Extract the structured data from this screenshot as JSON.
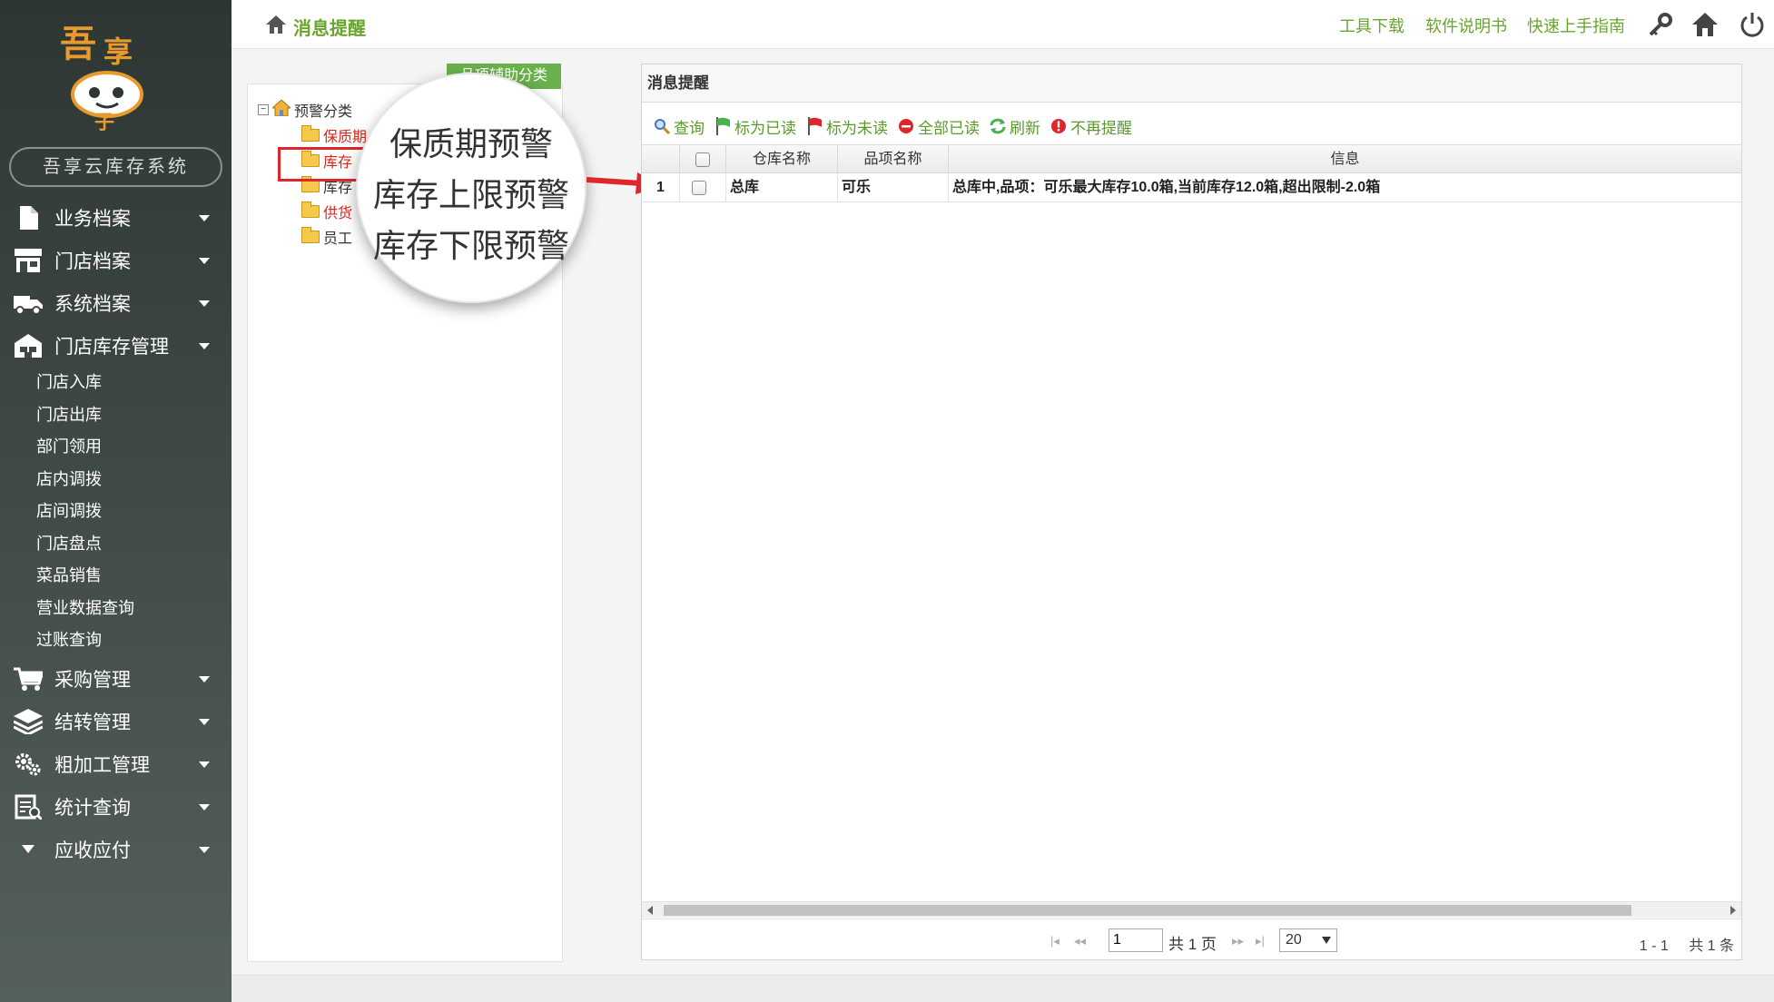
{
  "app": {
    "system_name": "吾享云库存系统"
  },
  "sidebar": {
    "menus": [
      {
        "label": "业务档案",
        "icon": "document-icon"
      },
      {
        "label": "门店档案",
        "icon": "store-icon"
      },
      {
        "label": "系统档案",
        "icon": "truck-icon"
      },
      {
        "label": "门店库存管理",
        "icon": "warehouse-icon"
      }
    ],
    "sub_items": [
      "门店入库",
      "门店出库",
      "部门领用",
      "店内调拨",
      "店间调拨",
      "门店盘点",
      "菜品销售",
      "营业数据查询",
      "过账查询"
    ],
    "menus_after": [
      {
        "label": "采购管理",
        "icon": "cart-icon"
      },
      {
        "label": "结转管理",
        "icon": "layers-icon"
      },
      {
        "label": "粗加工管理",
        "icon": "gears-icon"
      },
      {
        "label": "统计查询",
        "icon": "report-icon"
      },
      {
        "label": "应收应付",
        "icon": "triangle-down-icon"
      }
    ]
  },
  "topbar": {
    "breadcrumb": "消息提醒",
    "links": [
      "工具下载",
      "软件说明书",
      "快速上手指南"
    ]
  },
  "tree": {
    "tab_label": "品项辅助分类",
    "root": "预警分类",
    "nodes": [
      "保质期",
      "库存",
      "库存",
      "供货",
      "员工"
    ]
  },
  "callout": {
    "lines": [
      "保质期预警",
      "库存上限预警",
      "库存下限预警"
    ]
  },
  "grid": {
    "title": "消息提醒",
    "toolbar": [
      "查询",
      "标为已读",
      "标为未读",
      "全部已读",
      "刷新",
      "不再提醒"
    ],
    "columns": [
      "仓库名称",
      "品项名称",
      "信息"
    ],
    "rows": [
      {
        "num": "1",
        "warehouse": "总库",
        "item": "可乐",
        "message": "总库中,品项：可乐最大库存10.0箱,当前库存12.0箱,超出限制-2.0箱"
      }
    ],
    "pager": {
      "page": "1",
      "total_pages": "共 1 页",
      "page_size": "20",
      "range": "1 - 1",
      "total": "共 1 条"
    }
  },
  "colors": {
    "accent_green": "#6aa52e",
    "highlight_red": "#e0262d",
    "sidebar_dark": "#2d3632"
  }
}
